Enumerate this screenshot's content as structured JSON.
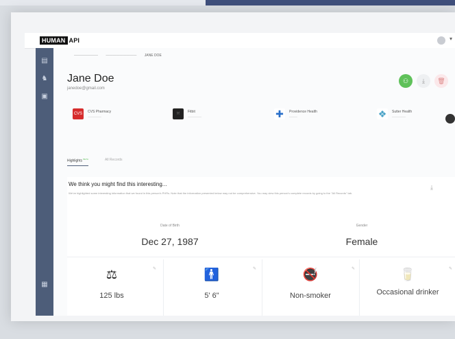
{
  "app": {
    "logo_main": "HUMAN",
    "logo_suffix": "API"
  },
  "breadcrumb": {
    "items": [
      "———————",
      "—————————",
      "JANE DOE"
    ]
  },
  "profile": {
    "name": "Jane Doe",
    "email": "janedoe@gmail.com",
    "actions": [
      {
        "icon": "person-icon",
        "color": "#5fc15a"
      },
      {
        "icon": "download-icon"
      },
      {
        "icon": "trash-icon"
      }
    ]
  },
  "sources": [
    {
      "name": "CVS Pharmacy",
      "sub": "—————",
      "icon": "cvs-icon",
      "color": "#d62c2c"
    },
    {
      "name": "Fitbit",
      "sub": "—————",
      "icon": "fitbit-icon",
      "color": "#222"
    },
    {
      "name": "Providence Health",
      "sub": "———",
      "icon": "cross-icon",
      "color": "#2a6fc9"
    },
    {
      "name": "Sutter Health",
      "sub": "—————",
      "icon": "sutter-icon",
      "color": "#4aa3c7"
    }
  ],
  "tabs": [
    {
      "label": "Highlights",
      "badge": "BETA",
      "active": true
    },
    {
      "label": "All Records",
      "active": false
    }
  ],
  "highlights": {
    "title": "We think you might find this interesting...",
    "description": "We've highlighted some interesting information that we found in this person's PHRs. Note that the information presented below may not be comprehensive. You may view this person's complete records by going to the \"All Records\" tab.",
    "fields": [
      {
        "label": "Date of Birth",
        "value": "Dec 27, 1987"
      },
      {
        "label": "Gender",
        "value": "Female"
      }
    ],
    "tiles": [
      {
        "icon": "scale-icon",
        "value": "125 lbs"
      },
      {
        "icon": "person-height-icon",
        "value": "5' 6\""
      },
      {
        "icon": "no-smoking-icon",
        "value": "Non-smoker"
      },
      {
        "icon": "drink-icon",
        "value": "Occasional drinker"
      }
    ]
  }
}
